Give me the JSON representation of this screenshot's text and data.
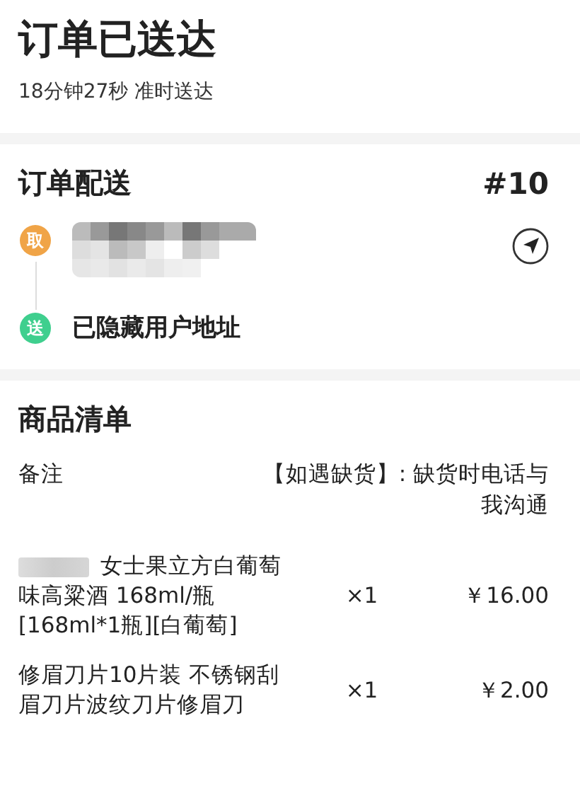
{
  "header": {
    "title": "订单已送达",
    "subtitle": "18分钟27秒 准时送达"
  },
  "delivery": {
    "title": "订单配送",
    "order_number": "#10",
    "stops": [
      {
        "kind": "pickup",
        "badge": "取",
        "color": "#f0a447"
      },
      {
        "kind": "dropoff",
        "badge": "送",
        "color": "#3fcf8e",
        "address": "已隐藏用户地址"
      }
    ]
  },
  "goods": {
    "title": "商品清单",
    "note": {
      "label": "备注",
      "value": "【如遇缺货】: 缺货时电话与我沟通"
    },
    "items": [
      {
        "name": "女士果立方白葡萄味高粱酒 168ml/瓶[168ml*1瓶][白葡萄]",
        "name_redacted": true,
        "quantity": "×1",
        "price": "￥16.00"
      },
      {
        "name": "修眉刀片10片装 不锈钢刮眉刀片波纹刀片修眉刀",
        "name_redacted": false,
        "quantity": "×1",
        "price": "￥2.00"
      }
    ]
  }
}
